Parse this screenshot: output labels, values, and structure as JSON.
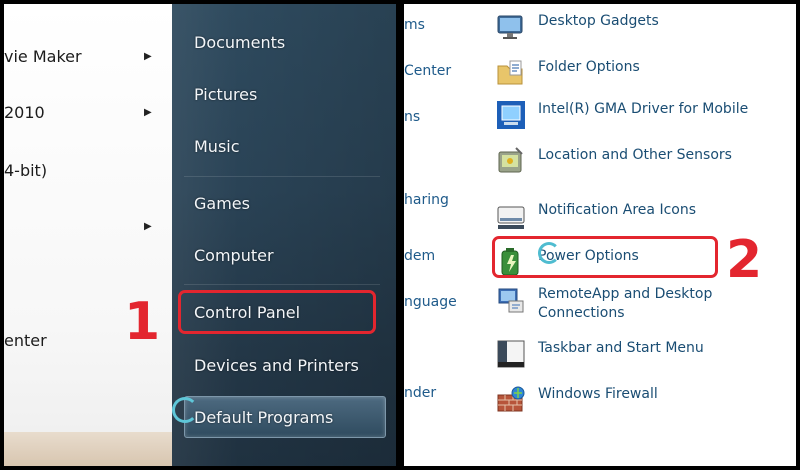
{
  "start_menu": {
    "programs": [
      {
        "label": "vie Maker",
        "has_arrow": true
      },
      {
        "label": " 2010",
        "has_arrow": true
      },
      {
        "label": "4-bit)",
        "has_arrow": false
      },
      {
        "label": "",
        "has_arrow": true
      },
      {
        "label": "enter",
        "has_arrow": false
      }
    ],
    "places": [
      "Documents",
      "Pictures",
      "Music",
      "Games",
      "Computer",
      "Control Panel",
      "Devices and Printers",
      "Default Programs"
    ],
    "step_badge": "1"
  },
  "control_panel": {
    "categories": [
      "ms",
      "Center",
      "ns",
      "haring",
      "dem",
      "nguage",
      "nder"
    ],
    "items": [
      {
        "label": "Desktop Gadgets",
        "icon": "desktop-gadgets-icon"
      },
      {
        "label": "Folder Options",
        "icon": "folder-options-icon"
      },
      {
        "label": "Intel(R) GMA Driver for Mobile",
        "icon": "intel-gma-icon"
      },
      {
        "label": "Location and Other Sensors",
        "icon": "location-sensors-icon"
      },
      {
        "label": "Notification Area Icons",
        "icon": "notification-area-icon"
      },
      {
        "label": "Power Options",
        "icon": "power-options-icon"
      },
      {
        "label": "RemoteApp and Desktop Connections",
        "icon": "remoteapp-icon"
      },
      {
        "label": "Taskbar and Start Menu",
        "icon": "taskbar-icon"
      },
      {
        "label": "Windows Firewall",
        "icon": "firewall-icon"
      }
    ],
    "step_badge": "2"
  },
  "colors": {
    "highlight": "#e3262f",
    "link": "#1a4d73",
    "start_menu_right": "#2a4356"
  }
}
